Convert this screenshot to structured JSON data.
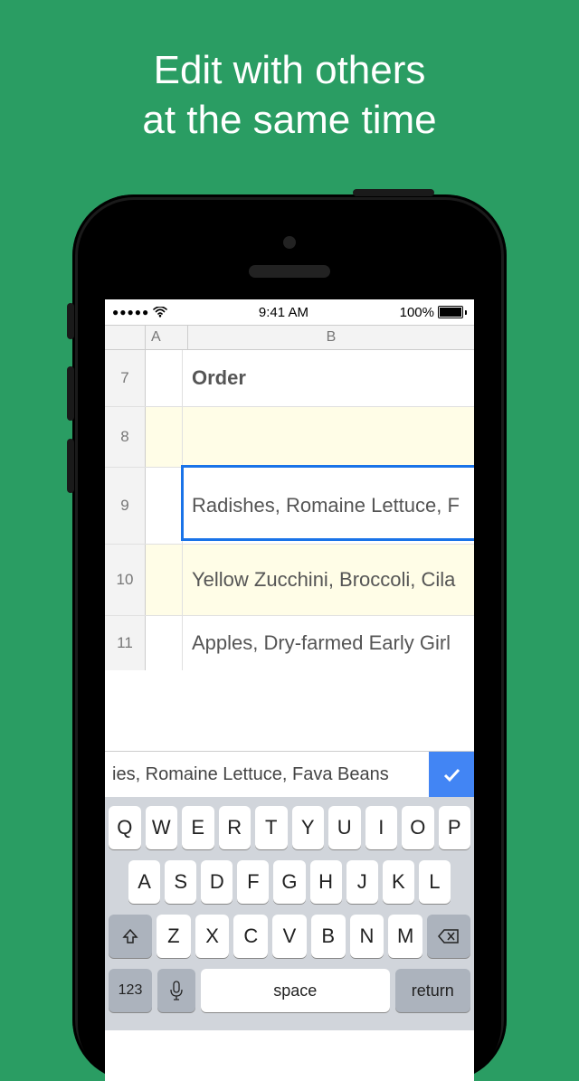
{
  "promo": {
    "line1": "Edit with others",
    "line2": "at the same time"
  },
  "status": {
    "time": "9:41 AM",
    "battery_pct": "100%"
  },
  "sheet": {
    "columns": [
      "A",
      "B"
    ],
    "rows": [
      {
        "num": "7",
        "value": "Order"
      },
      {
        "num": "8",
        "value": ""
      },
      {
        "num": "9",
        "value": "Radishes, Romaine Lettuce, F"
      },
      {
        "num": "10",
        "value": "Yellow Zucchini, Broccoli, Cila"
      },
      {
        "num": "11",
        "value": "Apples, Dry-farmed Early Girl"
      }
    ],
    "selected_row_index": 2
  },
  "edit_bar": {
    "text": "ies, Romaine Lettuce, Fava Beans"
  },
  "keyboard": {
    "row1": [
      "Q",
      "W",
      "E",
      "R",
      "T",
      "Y",
      "U",
      "I",
      "O",
      "P"
    ],
    "row2": [
      "A",
      "S",
      "D",
      "F",
      "G",
      "H",
      "J",
      "K",
      "L"
    ],
    "row3": [
      "Z",
      "X",
      "C",
      "V",
      "B",
      "N",
      "M"
    ],
    "num_key": "123",
    "space": "space",
    "return": "return"
  }
}
